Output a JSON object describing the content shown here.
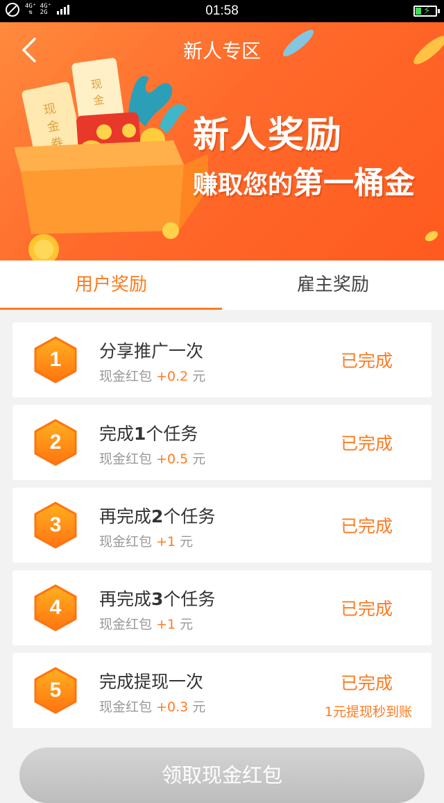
{
  "status_bar": {
    "network": "4G⁺ 4G⁺\n 2G",
    "time": "01:58"
  },
  "header": {
    "title": "新人专区",
    "back_icon": "chevron-left-icon"
  },
  "banner": {
    "headline": "新人奖励",
    "subline_prefix": "赚取您的",
    "subline_emphasis": "第一桶金",
    "coupon_text": "现金券",
    "coupon_text2": "现金"
  },
  "tabs": [
    {
      "label": "用户奖励",
      "active": true
    },
    {
      "label": "雇主奖励",
      "active": false
    }
  ],
  "tasks": [
    {
      "num": "1",
      "title": "分享推广一次",
      "title_parts": [
        "分享推广一次",
        "",
        ""
      ],
      "reward_label": "现金红包",
      "amount": "+0.2",
      "unit": "元",
      "status": "已完成",
      "note": ""
    },
    {
      "num": "2",
      "title_parts": [
        "完成",
        "1",
        "个任务"
      ],
      "reward_label": "现金红包",
      "amount": "+0.5",
      "unit": "元",
      "status": "已完成",
      "note": ""
    },
    {
      "num": "3",
      "title_parts": [
        "再完成",
        "2",
        "个任务"
      ],
      "reward_label": "现金红包",
      "amount": "+1",
      "unit": "元",
      "status": "已完成",
      "note": ""
    },
    {
      "num": "4",
      "title_parts": [
        "再完成",
        "3",
        "个任务"
      ],
      "reward_label": "现金红包",
      "amount": "+1",
      "unit": "元",
      "status": "已完成",
      "note": ""
    },
    {
      "num": "5",
      "title_parts": [
        "完成提现一次",
        "",
        ""
      ],
      "reward_label": "现金红包",
      "amount": "+0.3",
      "unit": "元",
      "status": "已完成",
      "note": "1元提现秒到账"
    }
  ],
  "claim_button": {
    "label": "领取现金红包"
  },
  "colors": {
    "accent": "#ff7a1f",
    "banner": "#ff6a2b",
    "disabled_button": "#c8c8c8"
  }
}
